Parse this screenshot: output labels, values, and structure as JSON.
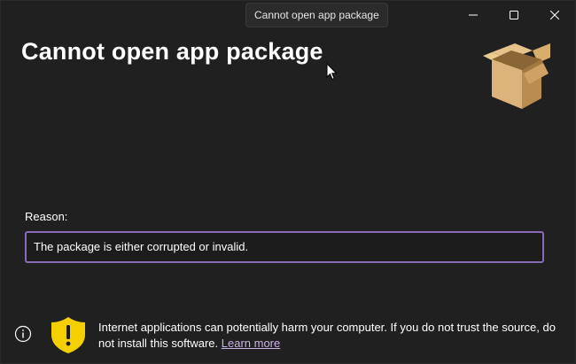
{
  "window": {
    "tooltip": "Cannot open app package",
    "title": "Cannot open app package"
  },
  "caption_buttons": {
    "minimize_icon": "minimize-icon",
    "maximize_icon": "maximize-icon",
    "close_icon": "close-icon"
  },
  "content": {
    "package_icon": "open-box-icon",
    "reason_label": "Reason:",
    "reason_value": "The package is either corrupted or invalid."
  },
  "footer": {
    "info_icon": "info-icon",
    "shield_icon": "warning-shield-icon",
    "warning_text": "Internet applications can potentially harm your computer. If you do not trust the source, do not install this software.",
    "learn_more": "Learn more"
  },
  "colors": {
    "background": "#202020",
    "accent_border": "#8a6ab8",
    "link": "#c9b3e6",
    "shield": "#f5d000"
  }
}
